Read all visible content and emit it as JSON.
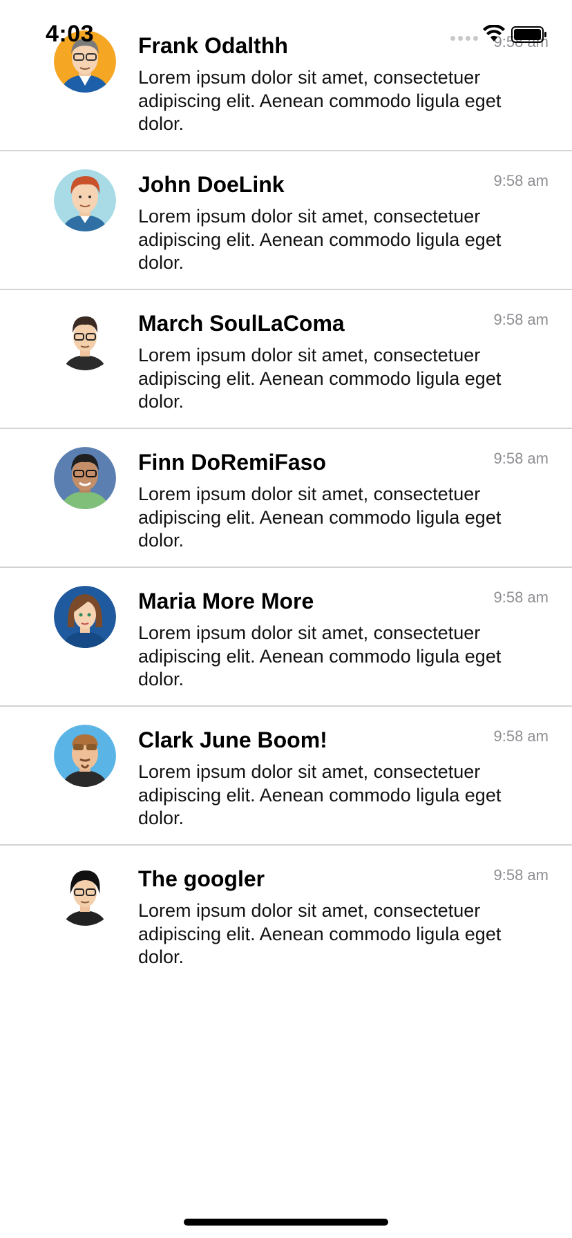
{
  "status_bar": {
    "time": "4:03"
  },
  "messages": [
    {
      "name": "Frank Odalthh",
      "time": "9:58 am",
      "text": "Lorem ipsum dolor sit amet, consectetuer adipiscing elit. Aenean commodo ligula eget dolor.",
      "avatar_color": "#f5a623"
    },
    {
      "name": "John DoeLink",
      "time": "9:58 am",
      "text": "Lorem ipsum dolor sit amet, consectetuer adipiscing elit. Aenean commodo ligula eget dolor.",
      "avatar_color": "#a8dbe6"
    },
    {
      "name": "March SoulLaComa",
      "time": "9:58 am",
      "text": "Lorem ipsum dolor sit amet, consectetuer adipiscing elit. Aenean commodo ligula eget dolor.",
      "avatar_color": "#ffffff"
    },
    {
      "name": "Finn DoRemiFaso",
      "time": "9:58 am",
      "text": "Lorem ipsum dolor sit amet, consectetuer adipiscing elit. Aenean commodo ligula eget dolor.",
      "avatar_color": "#5a7fb0"
    },
    {
      "name": "Maria More More",
      "time": "9:58 am",
      "text": "Lorem ipsum dolor sit amet, consectetuer adipiscing elit. Aenean commodo ligula eget dolor.",
      "avatar_color": "#1f5a9e"
    },
    {
      "name": "Clark June Boom!",
      "time": "9:58 am",
      "text": "Lorem ipsum dolor sit amet, consectetuer adipiscing elit. Aenean commodo ligula eget dolor.",
      "avatar_color": "#5ab4e6"
    },
    {
      "name": "The googler",
      "time": "9:58 am",
      "text": "Lorem ipsum dolor sit amet, consectetuer adipiscing elit. Aenean commodo ligula eget dolor.",
      "avatar_color": "#ffffff"
    }
  ]
}
